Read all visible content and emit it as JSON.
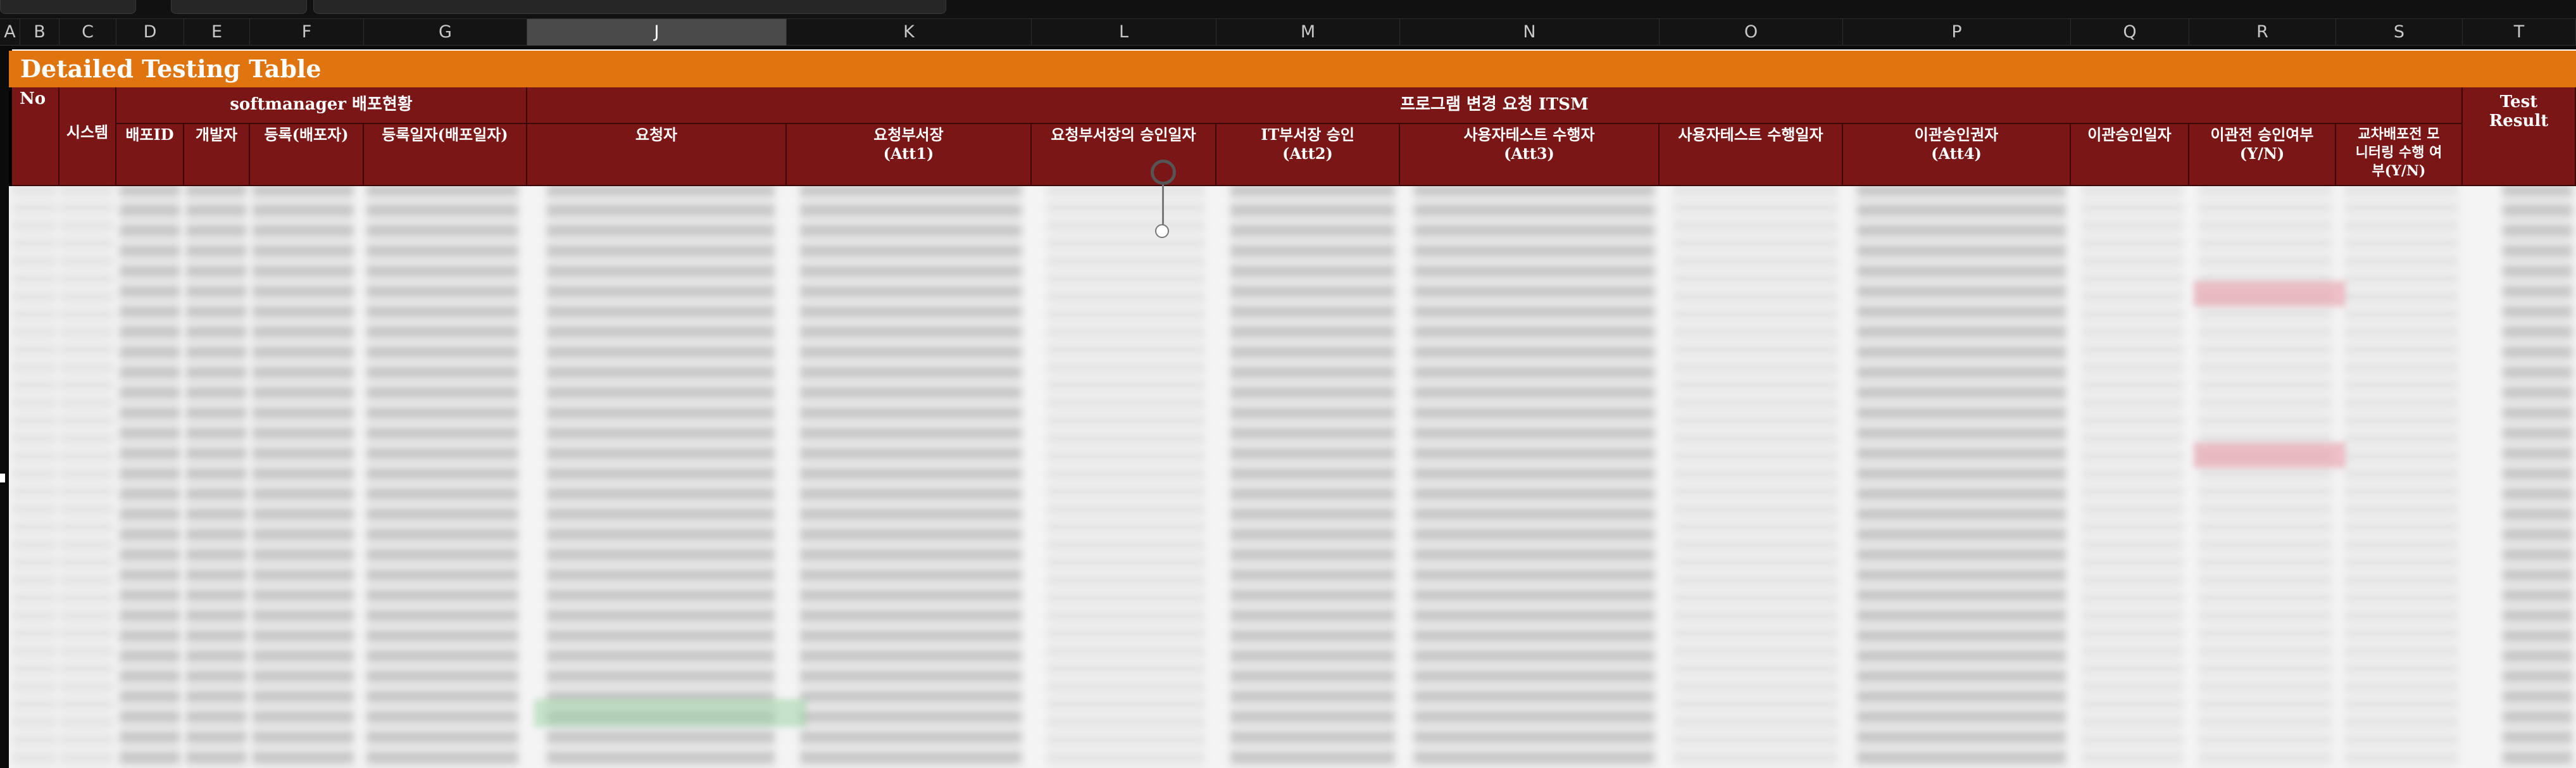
{
  "column_letters": [
    "A",
    "B",
    "C",
    "D",
    "E",
    "F",
    "G",
    "J",
    "K",
    "L",
    "M",
    "N",
    "O",
    "P",
    "Q",
    "R",
    "S",
    "T"
  ],
  "selected_column": "J",
  "sheet": {
    "title": "Detailed Testing Table",
    "headers": {
      "no": "No",
      "system": "시스템",
      "group_softmanager": "softmanager 배포현황",
      "deploy_id": "배포ID",
      "developer": "개발자",
      "registrant": "등록(배포자)",
      "reg_date": "등록일자(배포일자)",
      "group_itsm": "프로그램 변경 요청 ITSM",
      "requester": "요청자",
      "req_dept_head": "요청부서장\n(Att1)",
      "req_dept_head_date": "요청부서장의 승인일자",
      "it_dept_approval": "IT부서장 승인\n(Att2)",
      "user_test_performer": "사용자테스트 수행자\n(Att3)",
      "user_test_date": "사용자테스트 수행일자",
      "transfer_approver": "이관승인권자\n(Att4)",
      "transfer_approval_date": "이관승인일자",
      "pre_transfer_approval": "이관전 승인여부\n(Y/N)",
      "cross_monitoring": "교차배포전 모\n니터링 수행 여\n부(Y/N)",
      "test_result": "Test\nResult"
    }
  },
  "colors": {
    "title_bar": "#e0750f",
    "header_bg": "#7a1616",
    "highlight_pink": "#e696a0"
  },
  "icons": {
    "rotate_handle": "rotate-handle-icon",
    "resize_dot": "resize-handle-icon"
  }
}
